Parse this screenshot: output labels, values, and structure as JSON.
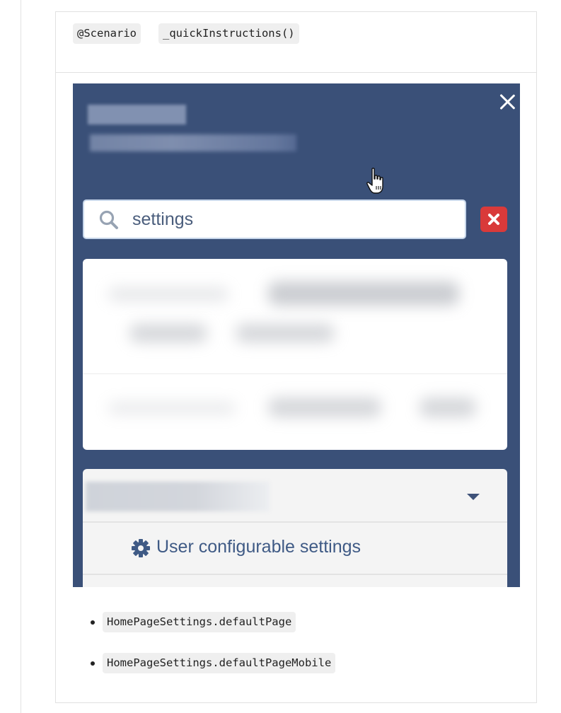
{
  "card": {
    "annotations": [
      "@Scenario",
      "_quickInstructions()"
    ]
  },
  "screenshot": {
    "search": {
      "value": "settings"
    },
    "menu_item_label": "User configurable settings",
    "colors": {
      "panel_bg": "#3a5078",
      "clear_button": "#d93a3a",
      "label": "#3f5a85"
    },
    "icons": [
      "close-icon",
      "search-icon",
      "clear-icon",
      "chevron-down-icon",
      "gear-icon",
      "pointer-cursor-icon"
    ]
  },
  "bullets": [
    "HomePageSettings.defaultPage",
    "HomePageSettings.defaultPageMobile"
  ]
}
